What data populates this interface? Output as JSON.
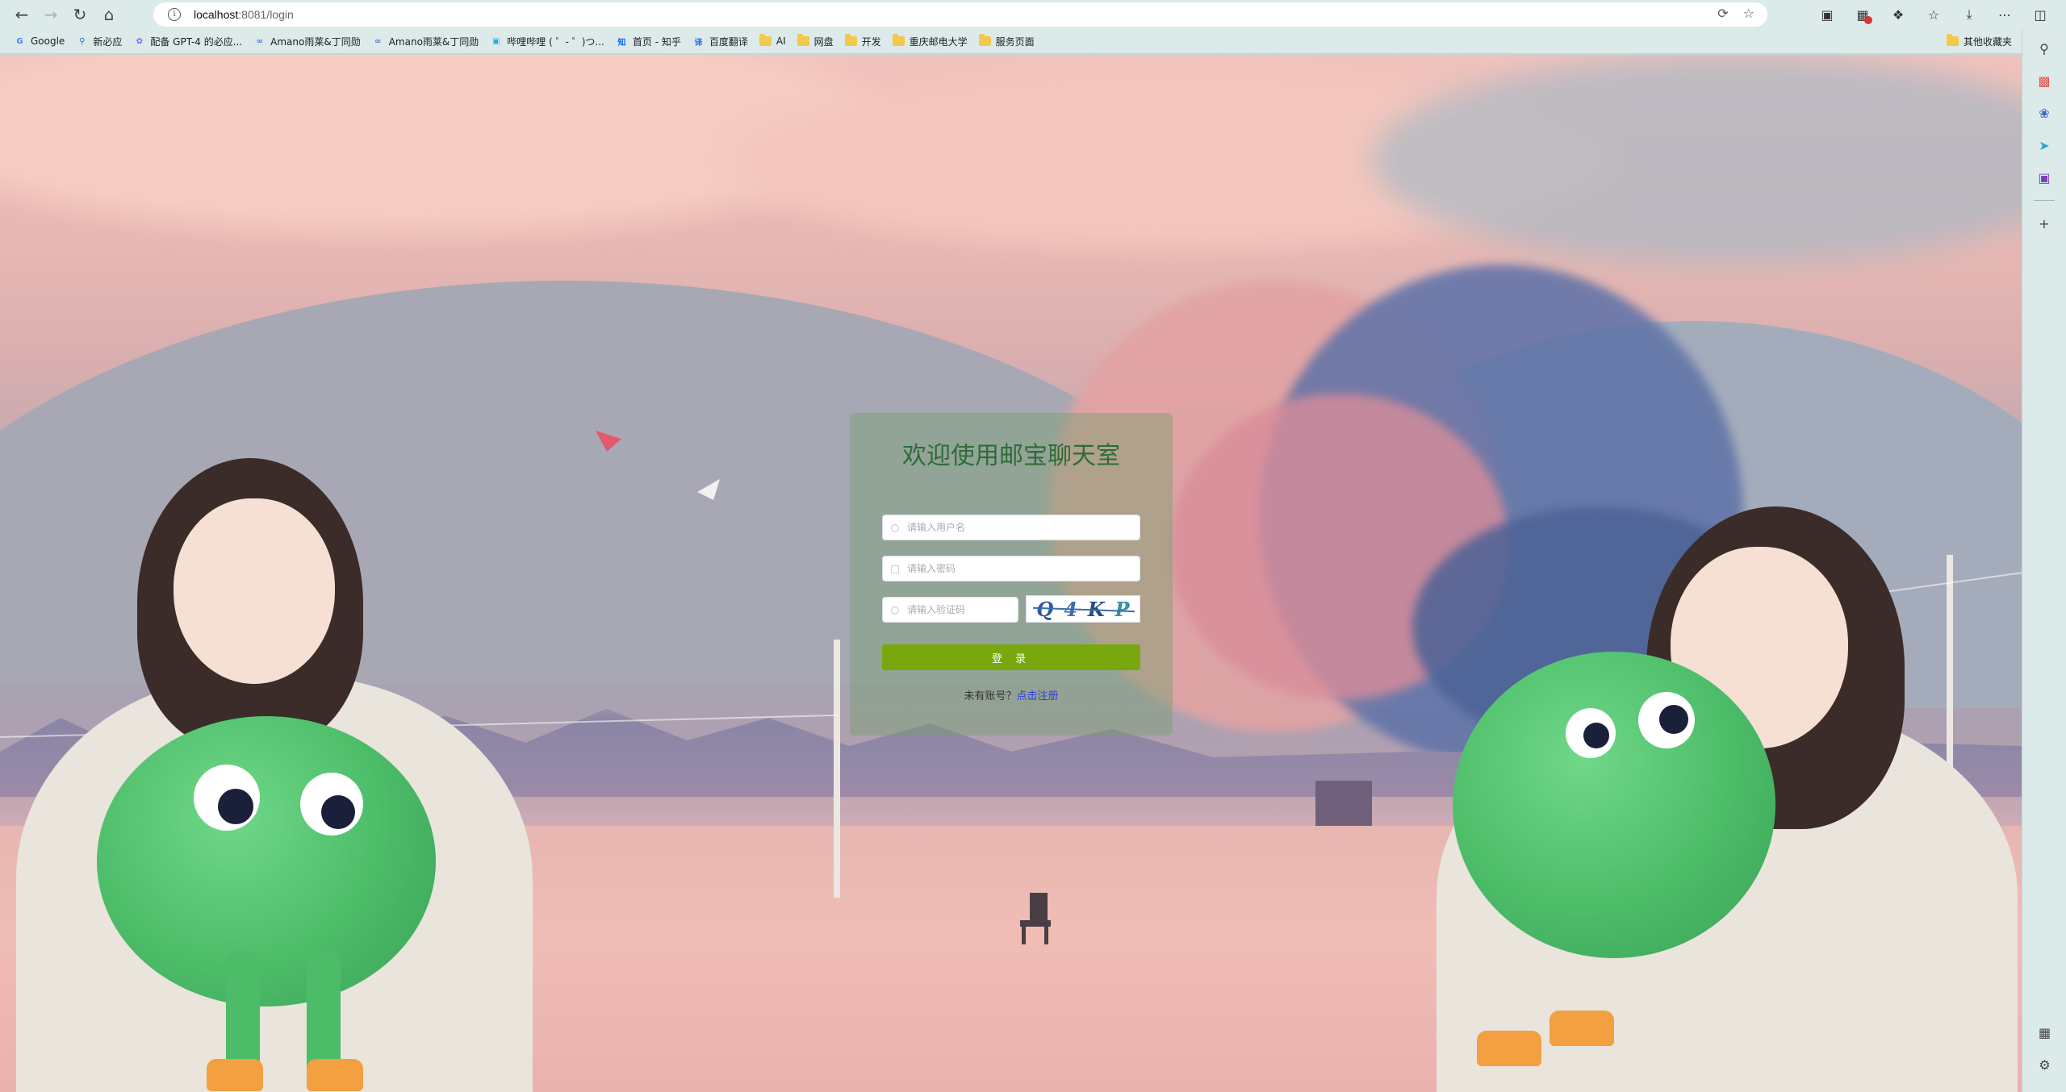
{
  "browser": {
    "url_host": "localhost",
    "url_rest": ":8081/login",
    "bookmarks": [
      {
        "label": "Google",
        "icon": "google-icon",
        "color": "#4285f4"
      },
      {
        "label": "新必应",
        "icon": "search-icon",
        "color": "#1a73e8"
      },
      {
        "label": "配备 GPT-4 的必应...",
        "icon": "bing-icon",
        "color": "#7b61ff"
      },
      {
        "label": "Amano雨莱&丁同勋",
        "icon": "link-icon",
        "color": "#3a7bd5"
      },
      {
        "label": "Amano雨莱&丁同勋",
        "icon": "link-icon",
        "color": "#3a7bd5"
      },
      {
        "label": "哔哩哔哩 ( ゜- ゜)つ...",
        "icon": "bilibili-icon",
        "color": "#23ade5"
      },
      {
        "label": "首页 - 知乎",
        "icon": "zhihu-icon",
        "color": "#0066ff"
      },
      {
        "label": "百度翻译",
        "icon": "translate-icon",
        "color": "#2e6ae8"
      },
      {
        "label": "AI",
        "icon": "folder-icon",
        "color": "#f2c94c"
      },
      {
        "label": "网盘",
        "icon": "folder-icon",
        "color": "#f2c94c"
      },
      {
        "label": "开发",
        "icon": "folder-icon",
        "color": "#f2c94c"
      },
      {
        "label": "重庆邮电大学",
        "icon": "folder-icon",
        "color": "#f2c94c"
      },
      {
        "label": "服务页面",
        "icon": "folder-icon",
        "color": "#f2c94c"
      }
    ],
    "other_bookmarks": "其他收藏夹"
  },
  "login": {
    "title": "欢迎使用邮宝聊天室",
    "username_placeholder": "请输入用户名",
    "password_placeholder": "请输入密码",
    "captcha_placeholder": "请输入验证码",
    "captcha_chars": [
      "Q",
      "4",
      "K",
      "P"
    ],
    "login_button": "登 录",
    "register_prompt": "未有账号？",
    "register_link": "点击注册",
    "accent": "#79a80e"
  }
}
